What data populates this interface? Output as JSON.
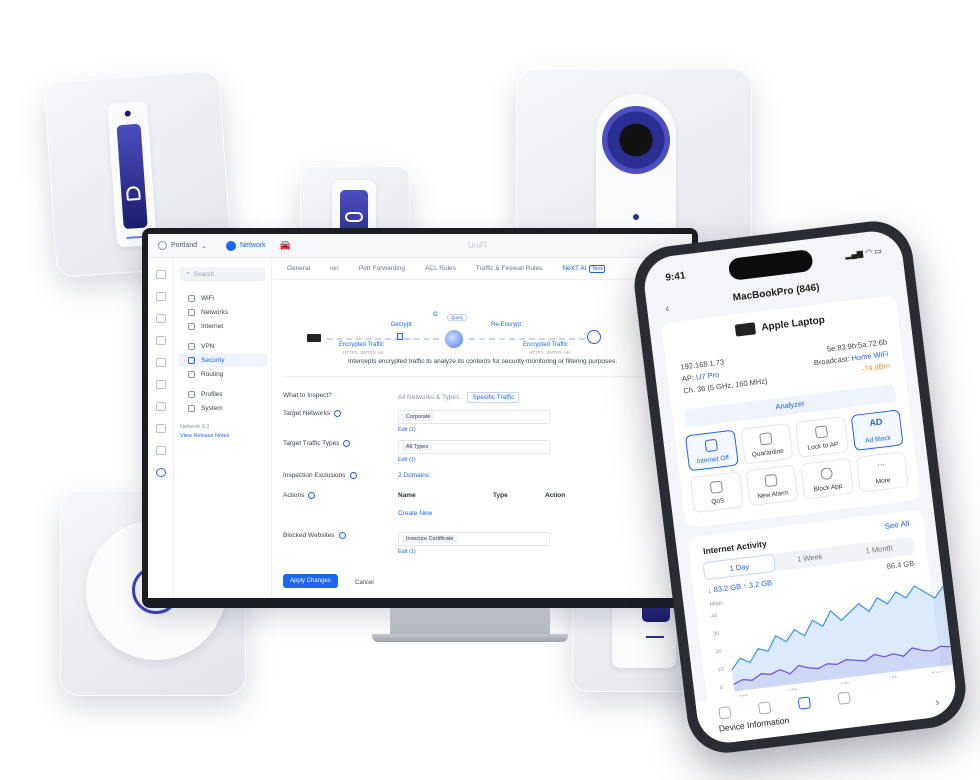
{
  "topbar": {
    "site": "Portland",
    "nav_network": "Network",
    "brand": "UniFi"
  },
  "sidebar": {
    "search_placeholder": "Search",
    "items": [
      {
        "label": "WiFi"
      },
      {
        "label": "Networks"
      },
      {
        "label": "Internet"
      },
      {
        "label": "VPN"
      },
      {
        "label": "Security"
      },
      {
        "label": "Routing"
      },
      {
        "label": "Profiles"
      },
      {
        "label": "System"
      }
    ],
    "version": "Network 9.3",
    "release_notes": "View Release Notes"
  },
  "tabs": [
    {
      "label": "General"
    },
    {
      "label": "ion"
    },
    {
      "label": "Port Forwarding"
    },
    {
      "label": "ACL Rules"
    },
    {
      "label": "Traffic & Firewall Rules"
    },
    {
      "label": "NeXT AI"
    }
  ],
  "tab_badge": "New",
  "flow": {
    "decrypt": "Decrypt",
    "reencrypt": "Re-Encrypt",
    "enc_left": "Encrypted Traffic",
    "enc_right": "Encrypted Traffic",
    "sub_left": "HTTPS, SMTPS, etc.",
    "sub_right": "HTTPS, SMTPS, etc.",
    "query": "Query",
    "google_g": "G"
  },
  "description": "Intercepts encrypted traffic to analyze its contents for security monitoring or filtering purposes.",
  "form": {
    "what_label": "What to Inspect?",
    "what_opt1": "All Networks & Types",
    "what_opt2": "Specific Traffic",
    "target_networks_label": "Target Networks",
    "target_networks_chip": "Corporate",
    "target_networks_edit": "Edit (1)",
    "target_types_label": "Target Traffic Types",
    "target_types_chip": "All Types",
    "target_types_edit": "Edit (1)",
    "exclusions_label": "Inspection Exclusions",
    "exclusions_value": "2 Domains",
    "actions_label": "Actions",
    "actions_cols": [
      "Name",
      "Type",
      "Action"
    ],
    "create_new": "Create New",
    "blocked_label": "Blocked Websites",
    "blocked_chip": "Insecure Certificate",
    "blocked_edit": "Edit (1)",
    "apply": "Apply Changes",
    "cancel": "Cancel"
  },
  "phone": {
    "time": "9:41",
    "title": "MacBookPro (846)",
    "device": "Apple Laptop",
    "ip": "192.168.1.73",
    "mac": "5e:83:9b:5a:72:6b",
    "ap_label": "AP:",
    "ap_value": "U7 Pro",
    "broadcast_label": "Broadcast:",
    "broadcast_value": "Home WiFi",
    "channel": "Ch. 36 (5 GHz, 160 MHz)",
    "signal": "-74 dBm",
    "analyzer": "Analyzer",
    "actions": [
      {
        "label": "Internet Off",
        "active": true
      },
      {
        "label": "Quarantine",
        "active": false
      },
      {
        "label": "Lock to AP",
        "active": false
      },
      {
        "label": "Ad Block",
        "active": true
      },
      {
        "label": "QoS",
        "active": false
      },
      {
        "label": "New Alarm",
        "active": false
      },
      {
        "label": "Block App",
        "active": false
      },
      {
        "label": "More",
        "active": false
      }
    ],
    "ad_glyph": "AD",
    "internet_activity": "Internet Activity",
    "see_all": "See All",
    "ranges": [
      "1 Day",
      "1 Week",
      "1 Month"
    ],
    "down": "↓ 83.2 GB",
    "up": "↑ 3.2 GB",
    "total": "86.4 GB",
    "device_info": "Device Information"
  },
  "chart_data": {
    "type": "area",
    "ylabel": "Mbps",
    "y_ticks": [
      "40",
      "30",
      "20",
      "10",
      "0"
    ],
    "x_ticks": [
      "-24h",
      "-18h",
      "-12h",
      "-6h",
      "Now"
    ],
    "ylim": [
      0,
      50
    ],
    "series": [
      {
        "color": "#3a8ff0",
        "values": [
          12,
          18,
          15,
          22,
          20,
          28,
          24,
          30,
          26,
          34,
          30,
          38,
          32,
          36,
          40,
          35,
          42,
          38,
          44,
          40,
          46,
          42,
          38,
          44
        ]
      },
      {
        "color": "#6b4fd8",
        "values": [
          4,
          6,
          5,
          8,
          7,
          9,
          6,
          10,
          8,
          7,
          9,
          8,
          10,
          9,
          8,
          11,
          9,
          10,
          8,
          12,
          10,
          9,
          11,
          10
        ]
      }
    ]
  },
  "colors": {
    "accent": "#1c64f2",
    "signal": "#e9912b",
    "device_screen": "#2b2e93"
  }
}
